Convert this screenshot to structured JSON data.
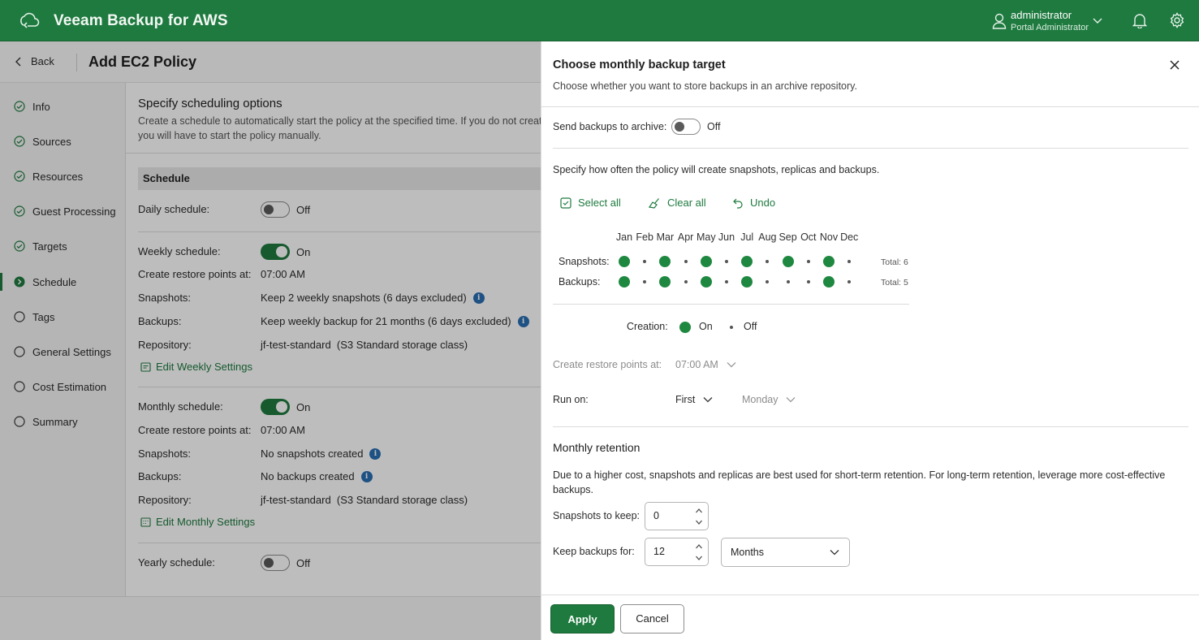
{
  "app": {
    "title": "Veeam Backup for AWS"
  },
  "user": {
    "name": "administrator",
    "role": "Portal Administrator"
  },
  "page": {
    "back_label": "Back",
    "title": "Add EC2 Policy"
  },
  "nav": {
    "items": [
      {
        "label": "Info",
        "state": "done"
      },
      {
        "label": "Sources",
        "state": "done"
      },
      {
        "label": "Resources",
        "state": "done"
      },
      {
        "label": "Guest Processing",
        "state": "done"
      },
      {
        "label": "Targets",
        "state": "done"
      },
      {
        "label": "Schedule",
        "state": "active"
      },
      {
        "label": "Tags",
        "state": "pending"
      },
      {
        "label": "General Settings",
        "state": "pending"
      },
      {
        "label": "Cost Estimation",
        "state": "pending"
      },
      {
        "label": "Summary",
        "state": "pending"
      }
    ]
  },
  "content": {
    "title": "Specify scheduling options",
    "desc_line1": "Create a schedule to automatically start the policy at the specified time. If you do not create",
    "desc_line2": "you will have to start the policy manually.",
    "schedule_header": "Schedule",
    "daily": {
      "label": "Daily schedule:",
      "state": "Off"
    },
    "weekly": {
      "label": "Weekly schedule:",
      "state": "On",
      "restore_label": "Create restore points at:",
      "restore_value": "07:00 AM",
      "snapshots_label": "Snapshots:",
      "snapshots_value": "Keep 2 weekly snapshots (6 days excluded)",
      "backups_label": "Backups:",
      "backups_value": "Keep weekly backup for 21 months (6 days excluded)",
      "repository_label": "Repository:",
      "repository_value": "jf-test-standard  (S3 Standard storage class)",
      "edit_label": "Edit Weekly Settings"
    },
    "monthly": {
      "label": "Monthly schedule:",
      "state": "On",
      "restore_label": "Create restore points at:",
      "restore_value": "07:00 AM",
      "snapshots_label": "Snapshots:",
      "snapshots_value": "No snapshots created",
      "backups_label": "Backups:",
      "backups_value": "No backups created",
      "repository_label": "Repository:",
      "repository_value": "jf-test-standard  (S3 Standard storage class)",
      "edit_label": "Edit Monthly Settings"
    },
    "yearly": {
      "label": "Yearly schedule:",
      "state": "Off"
    }
  },
  "drawer": {
    "title": "Choose monthly backup target",
    "subtitle": "Choose whether you want to store backups in an archive repository.",
    "archive_label": "Send backups to archive:",
    "archive_state": "Off",
    "specify_text": "Specify how often the policy will create snapshots, replicas and backups.",
    "select_all": "Select all",
    "clear_all": "Clear all",
    "undo": "Undo",
    "months": [
      "Jan",
      "Feb",
      "Mar",
      "Apr",
      "May",
      "Jun",
      "Jul",
      "Aug",
      "Sep",
      "Oct",
      "Nov",
      "Dec"
    ],
    "snapshots_row_label": "Snapshots:",
    "backups_row_label": "Backups:",
    "snapshots_on": [
      1,
      0,
      1,
      0,
      1,
      0,
      1,
      0,
      1,
      0,
      1,
      0
    ],
    "backups_on": [
      1,
      0,
      1,
      0,
      1,
      0,
      1,
      0,
      0,
      0,
      1,
      0
    ],
    "snapshots_total": "Total: 6",
    "backups_total": "Total: 5",
    "creation_label": "Creation:",
    "legend_on": "On",
    "legend_off": "Off",
    "restore_label": "Create restore points at:",
    "restore_value": "07:00 AM",
    "run_on_label": "Run on:",
    "run_on_value": "First",
    "run_on_day": "Monday",
    "retention_title": "Monthly retention",
    "retention_desc_1": "Due to a higher cost, snapshots and replicas are best used for short-term retention. For long-term retention, leverage more cost-effective",
    "retention_desc_2": "backups.",
    "snapshots_keep_label": "Snapshots to keep:",
    "snapshots_keep_value": "0",
    "keep_backups_label": "Keep backups for:",
    "keep_backups_value": "12",
    "keep_backups_unit": "Months",
    "apply_label": "Apply",
    "cancel_label": "Cancel"
  },
  "colors": {
    "brand": "#1e7a3f",
    "dot": "#1e8840",
    "info": "#2b6fb3"
  }
}
